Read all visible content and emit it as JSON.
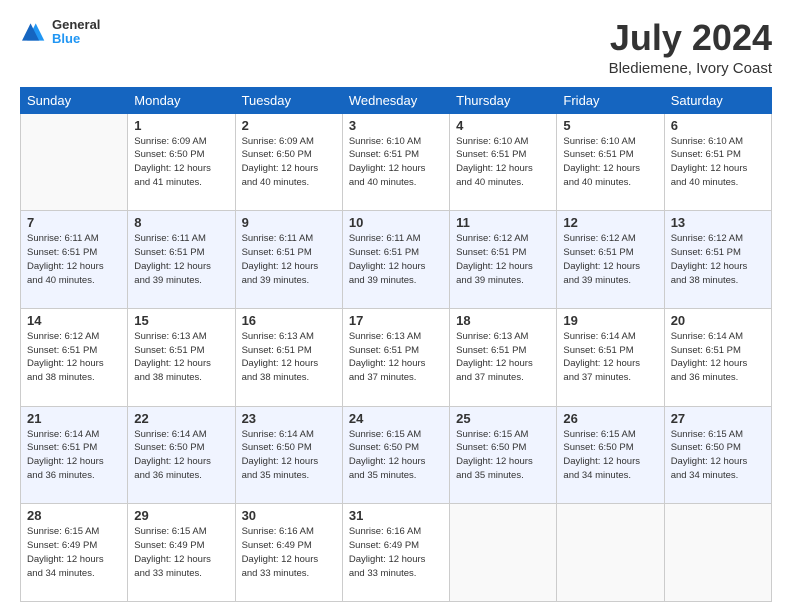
{
  "header": {
    "logo_line1": "General",
    "logo_line2": "Blue",
    "main_title": "July 2024",
    "sub_title": "Blediemene, Ivory Coast"
  },
  "calendar": {
    "days_of_week": [
      "Sunday",
      "Monday",
      "Tuesday",
      "Wednesday",
      "Thursday",
      "Friday",
      "Saturday"
    ],
    "weeks": [
      [
        {
          "day": "",
          "info": ""
        },
        {
          "day": "1",
          "info": "Sunrise: 6:09 AM\nSunset: 6:50 PM\nDaylight: 12 hours\nand 41 minutes."
        },
        {
          "day": "2",
          "info": "Sunrise: 6:09 AM\nSunset: 6:50 PM\nDaylight: 12 hours\nand 40 minutes."
        },
        {
          "day": "3",
          "info": "Sunrise: 6:10 AM\nSunset: 6:51 PM\nDaylight: 12 hours\nand 40 minutes."
        },
        {
          "day": "4",
          "info": "Sunrise: 6:10 AM\nSunset: 6:51 PM\nDaylight: 12 hours\nand 40 minutes."
        },
        {
          "day": "5",
          "info": "Sunrise: 6:10 AM\nSunset: 6:51 PM\nDaylight: 12 hours\nand 40 minutes."
        },
        {
          "day": "6",
          "info": "Sunrise: 6:10 AM\nSunset: 6:51 PM\nDaylight: 12 hours\nand 40 minutes."
        }
      ],
      [
        {
          "day": "7",
          "info": "Sunrise: 6:11 AM\nSunset: 6:51 PM\nDaylight: 12 hours\nand 40 minutes."
        },
        {
          "day": "8",
          "info": "Sunrise: 6:11 AM\nSunset: 6:51 PM\nDaylight: 12 hours\nand 39 minutes."
        },
        {
          "day": "9",
          "info": "Sunrise: 6:11 AM\nSunset: 6:51 PM\nDaylight: 12 hours\nand 39 minutes."
        },
        {
          "day": "10",
          "info": "Sunrise: 6:11 AM\nSunset: 6:51 PM\nDaylight: 12 hours\nand 39 minutes."
        },
        {
          "day": "11",
          "info": "Sunrise: 6:12 AM\nSunset: 6:51 PM\nDaylight: 12 hours\nand 39 minutes."
        },
        {
          "day": "12",
          "info": "Sunrise: 6:12 AM\nSunset: 6:51 PM\nDaylight: 12 hours\nand 39 minutes."
        },
        {
          "day": "13",
          "info": "Sunrise: 6:12 AM\nSunset: 6:51 PM\nDaylight: 12 hours\nand 38 minutes."
        }
      ],
      [
        {
          "day": "14",
          "info": "Sunrise: 6:12 AM\nSunset: 6:51 PM\nDaylight: 12 hours\nand 38 minutes."
        },
        {
          "day": "15",
          "info": "Sunrise: 6:13 AM\nSunset: 6:51 PM\nDaylight: 12 hours\nand 38 minutes."
        },
        {
          "day": "16",
          "info": "Sunrise: 6:13 AM\nSunset: 6:51 PM\nDaylight: 12 hours\nand 38 minutes."
        },
        {
          "day": "17",
          "info": "Sunrise: 6:13 AM\nSunset: 6:51 PM\nDaylight: 12 hours\nand 37 minutes."
        },
        {
          "day": "18",
          "info": "Sunrise: 6:13 AM\nSunset: 6:51 PM\nDaylight: 12 hours\nand 37 minutes."
        },
        {
          "day": "19",
          "info": "Sunrise: 6:14 AM\nSunset: 6:51 PM\nDaylight: 12 hours\nand 37 minutes."
        },
        {
          "day": "20",
          "info": "Sunrise: 6:14 AM\nSunset: 6:51 PM\nDaylight: 12 hours\nand 36 minutes."
        }
      ],
      [
        {
          "day": "21",
          "info": "Sunrise: 6:14 AM\nSunset: 6:51 PM\nDaylight: 12 hours\nand 36 minutes."
        },
        {
          "day": "22",
          "info": "Sunrise: 6:14 AM\nSunset: 6:50 PM\nDaylight: 12 hours\nand 36 minutes."
        },
        {
          "day": "23",
          "info": "Sunrise: 6:14 AM\nSunset: 6:50 PM\nDaylight: 12 hours\nand 35 minutes."
        },
        {
          "day": "24",
          "info": "Sunrise: 6:15 AM\nSunset: 6:50 PM\nDaylight: 12 hours\nand 35 minutes."
        },
        {
          "day": "25",
          "info": "Sunrise: 6:15 AM\nSunset: 6:50 PM\nDaylight: 12 hours\nand 35 minutes."
        },
        {
          "day": "26",
          "info": "Sunrise: 6:15 AM\nSunset: 6:50 PM\nDaylight: 12 hours\nand 34 minutes."
        },
        {
          "day": "27",
          "info": "Sunrise: 6:15 AM\nSunset: 6:50 PM\nDaylight: 12 hours\nand 34 minutes."
        }
      ],
      [
        {
          "day": "28",
          "info": "Sunrise: 6:15 AM\nSunset: 6:49 PM\nDaylight: 12 hours\nand 34 minutes."
        },
        {
          "day": "29",
          "info": "Sunrise: 6:15 AM\nSunset: 6:49 PM\nDaylight: 12 hours\nand 33 minutes."
        },
        {
          "day": "30",
          "info": "Sunrise: 6:16 AM\nSunset: 6:49 PM\nDaylight: 12 hours\nand 33 minutes."
        },
        {
          "day": "31",
          "info": "Sunrise: 6:16 AM\nSunset: 6:49 PM\nDaylight: 12 hours\nand 33 minutes."
        },
        {
          "day": "",
          "info": ""
        },
        {
          "day": "",
          "info": ""
        },
        {
          "day": "",
          "info": ""
        }
      ]
    ]
  }
}
